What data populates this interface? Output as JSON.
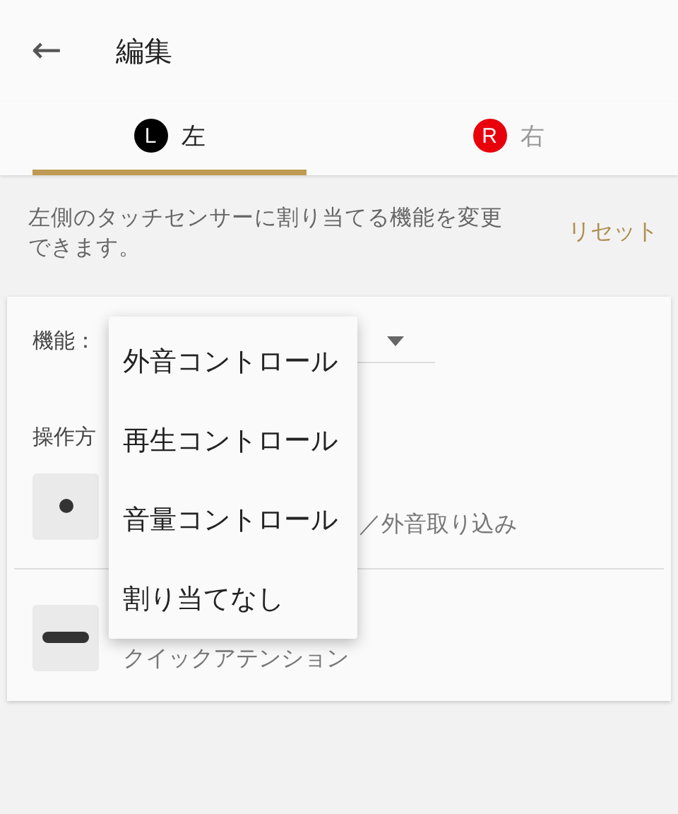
{
  "header": {
    "back_icon": "←",
    "title": "編集"
  },
  "tabs": [
    {
      "badge": "L",
      "label": "左",
      "selected": true
    },
    {
      "badge": "R",
      "label": "右",
      "selected": false
    }
  ],
  "description": "左側のタッチセンサーに割り当てる機能を変更できます。",
  "reset": "リセット",
  "function_label": "機能：",
  "method_label": "操作方",
  "operations": [
    {
      "kind": "tap",
      "subtitle": "／外音取り込み"
    },
    {
      "kind": "hold",
      "subtitle": "クイックアテンション"
    }
  ],
  "menu": [
    "外音コントロール",
    "再生コントロール",
    "音量コントロール",
    "割り当てなし"
  ]
}
